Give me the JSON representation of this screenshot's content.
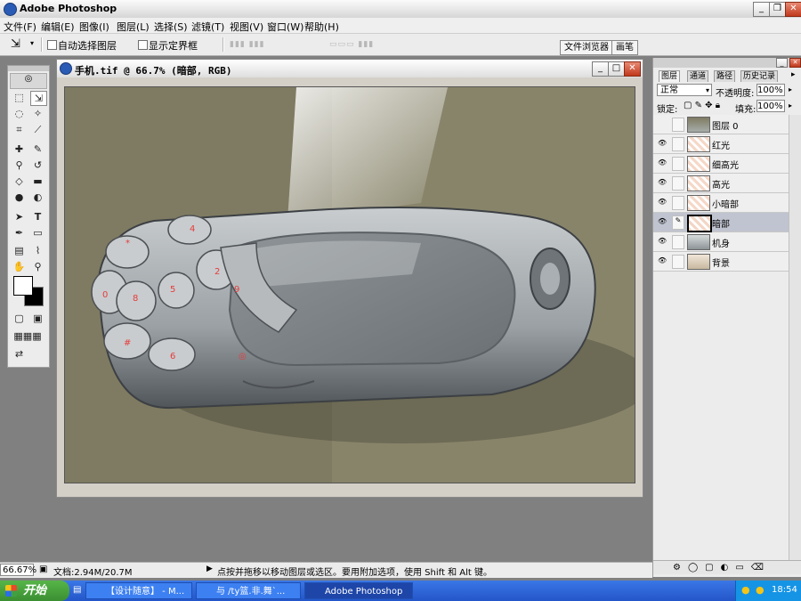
{
  "app": {
    "title": "Adobe Photoshop"
  },
  "menu": [
    "文件(F)",
    "编辑(E)",
    "图像(I)",
    "图层(L)",
    "选择(S)",
    "滤镜(T)",
    "视图(V)",
    "窗口(W)",
    "帮助(H)"
  ],
  "options": {
    "auto_select_label": "自动选择图层",
    "show_bounds_label": "显示定界框",
    "tabs": [
      "文件浏览器",
      "画笔"
    ]
  },
  "document": {
    "title": "手机.tif @ 66.7% (暗部, RGB)"
  },
  "panel": {
    "tabs": [
      "图层",
      "通道",
      "路径",
      "历史记录"
    ],
    "blend_mode": "正常",
    "opacity_label": "不透明度:",
    "opacity_value": "100%",
    "lock_label": "锁定:",
    "fill_label": "填充:",
    "fill_value": "100%",
    "layers": [
      {
        "name": "图层 0",
        "visible": false,
        "selected": false
      },
      {
        "name": "红光",
        "visible": true,
        "selected": false
      },
      {
        "name": "细高光",
        "visible": true,
        "selected": false
      },
      {
        "name": "高光",
        "visible": true,
        "selected": false
      },
      {
        "name": "小暗部",
        "visible": true,
        "selected": false
      },
      {
        "name": "暗部",
        "visible": true,
        "selected": true
      },
      {
        "name": "机身",
        "visible": true,
        "selected": false
      },
      {
        "name": "背景",
        "visible": true,
        "selected": false
      }
    ]
  },
  "status": {
    "zoom": "66.67%",
    "doc_info": "文档:2.94M/20.7M",
    "hint": "点按并拖移以移动图层或选区。要用附加选项，使用 Shift 和 Alt 键。"
  },
  "taskbar": {
    "start_label": "开始",
    "items": [
      "【设计随意】 - M...",
      "与 /ty篮.非.舞`...",
      "Adobe Photoshop"
    ],
    "clock": "18:54"
  },
  "colors": {
    "accent": "#2456c9",
    "selected_layer": "#c0c4d0"
  }
}
